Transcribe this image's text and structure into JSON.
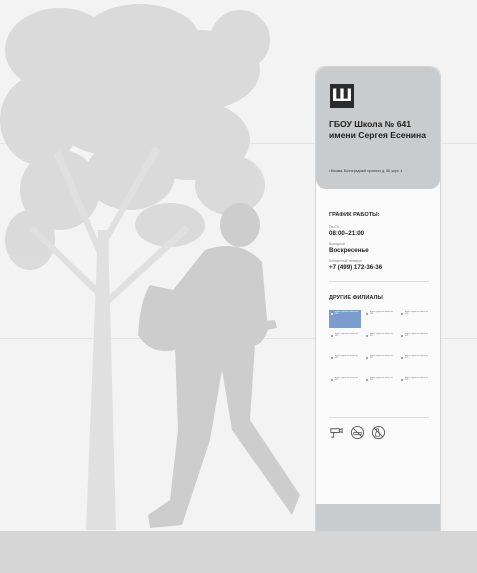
{
  "sign": {
    "logo_letter": "Ш",
    "school_name_line1": "ГБОУ Школа № 641",
    "school_name_line2": "имени Сергея Есенина",
    "address": "г.Москва, Волгоградский проспект, д. 88, корп. 4",
    "schedule": {
      "title": "ГРАФИК РАБОТЫ:",
      "weekdays_label": "Пн-Сб",
      "weekdays_hours": "08:00–21:00",
      "dayoff_label": "Выходной",
      "dayoff_value": "Воскресенье",
      "phone_label": "Контактный телефон",
      "phone": "+7 (499) 172-36-36"
    },
    "branches_title": "ДРУГИЕ ФИЛИАЛЫ",
    "branch_text": "Адрес отделения школы № 641 ...",
    "icons": [
      "cctv-camera-icon",
      "no-smoking-icon",
      "no-alcohol-icon"
    ]
  },
  "colors": {
    "panel_header": "#c9ccce",
    "highlight_branch": "#7b9ccc",
    "silhouette": "#cfcfcf"
  }
}
